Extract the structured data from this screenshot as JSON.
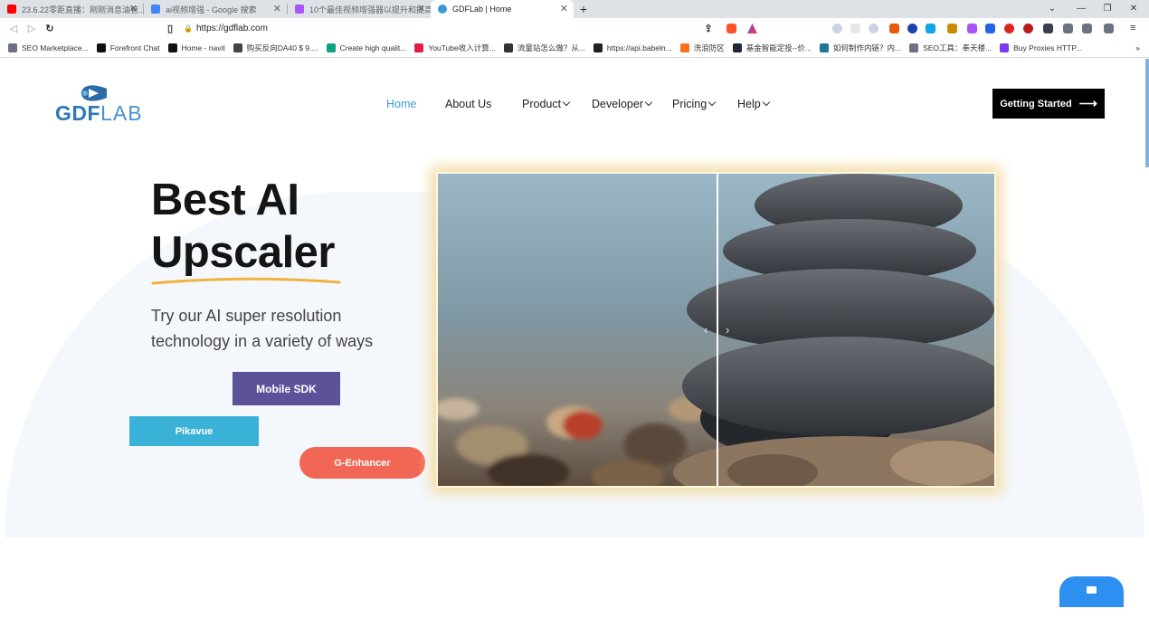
{
  "browser": {
    "tabs": [
      {
        "title": "23.6.22零距直播：刚刚消息油管...",
        "favicon_color": "#ff0000",
        "active": false
      },
      {
        "title": "ai视频增强 - Google 搜索",
        "favicon_color": "#4285f4",
        "active": false
      },
      {
        "title": "10个最佳视频增强器以提升和提高视...",
        "favicon_color": "#a855f7",
        "active": false
      },
      {
        "title": "GDFLab | Home",
        "favicon_color": "#3d9ad1",
        "active": true
      }
    ],
    "url": "https://gdflab.com",
    "bookmarks": [
      {
        "label": "SEO Marketplace...",
        "color": "#6b7280"
      },
      {
        "label": "Forefront Chat",
        "color": "#111111"
      },
      {
        "label": "Home - navit",
        "color": "#111111"
      },
      {
        "label": "购买反向DA40 $ 9....",
        "color": "#444444"
      },
      {
        "label": "Create high qualit...",
        "color": "#10a37f"
      },
      {
        "label": "YouTube收入计算...",
        "color": "#e11d48"
      },
      {
        "label": "流量站怎么做？从...",
        "color": "#333333"
      },
      {
        "label": "https://api.babeln...",
        "color": "#222222"
      },
      {
        "label": "洗浪防区",
        "color": "#f97316"
      },
      {
        "label": "基金智能定投--价...",
        "color": "#1f2937"
      },
      {
        "label": "如何制作内链？内...",
        "color": "#21759b"
      },
      {
        "label": "SEO工具：奉天楼...",
        "color": "#6b7280"
      },
      {
        "label": "Buy Proxies HTTP...",
        "color": "#7c3aed"
      }
    ]
  },
  "site": {
    "logo_left": "GDF",
    "logo_right": "LAB",
    "nav": [
      {
        "label": "Home",
        "dropdown": false,
        "active": true
      },
      {
        "label": "About Us",
        "dropdown": false,
        "active": false
      },
      {
        "label": "Product",
        "dropdown": true,
        "active": false
      },
      {
        "label": "Developer",
        "dropdown": true,
        "active": false
      },
      {
        "label": "Pricing",
        "dropdown": true,
        "active": false
      },
      {
        "label": "Help",
        "dropdown": true,
        "active": false
      }
    ],
    "cta": "Getting Started",
    "hero": {
      "title_line1": "Best AI",
      "title_line2": "Upscaler",
      "subtitle": "Try our AI super resolution technology in a variety of ways",
      "btn_sdk": "Mobile SDK",
      "btn_pikavue": "Pikavue",
      "btn_genhancer": "G-Enhancer"
    },
    "colors": {
      "accent": "#3d9ad1",
      "sdk": "#5d5299",
      "pikavue": "#3ab2d8",
      "genhancer": "#f26656",
      "chat": "#2d8ff0"
    }
  }
}
